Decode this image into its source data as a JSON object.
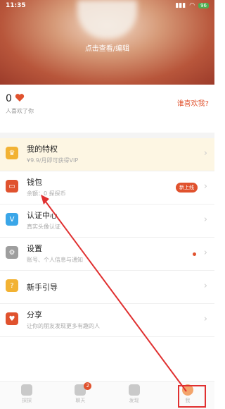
{
  "status_bar": {
    "time": "11:35",
    "battery": "96"
  },
  "header": {
    "edit_hint": "点击查看/编辑"
  },
  "likes": {
    "count": "0",
    "caption": "人喜欢了你",
    "who_likes": "谁喜欢我?"
  },
  "menu": [
    {
      "title": "我的特权",
      "subtitle": "¥9.9/月即可获得VIP",
      "icon": "crown-icon",
      "color": "#f2b233"
    },
    {
      "title": "钱包",
      "subtitle": "余额：0 探探币",
      "icon": "wallet-icon",
      "color": "#e0522e",
      "badge": "新上线"
    },
    {
      "title": "认证中心",
      "subtitle": "真实头像认证",
      "icon": "verify-icon",
      "color": "#3aa6e8"
    },
    {
      "title": "设置",
      "subtitle": "账号、个人信息与通知",
      "icon": "gear-icon",
      "color": "#9e9e9e"
    },
    {
      "title": "新手引导",
      "subtitle": "",
      "icon": "question-icon",
      "color": "#f2b233"
    },
    {
      "title": "分享",
      "subtitle": "让你的朋友发现更多有趣的人",
      "icon": "heart-share-icon",
      "color": "#e0522e"
    }
  ],
  "tabs": [
    {
      "label": "探探",
      "badge": ""
    },
    {
      "label": "聊天",
      "badge": "2"
    },
    {
      "label": "发现",
      "badge": ""
    },
    {
      "label": "我",
      "badge": ""
    }
  ],
  "colors": {
    "accent": "#e0522e",
    "highlight_box": "#e03030"
  }
}
